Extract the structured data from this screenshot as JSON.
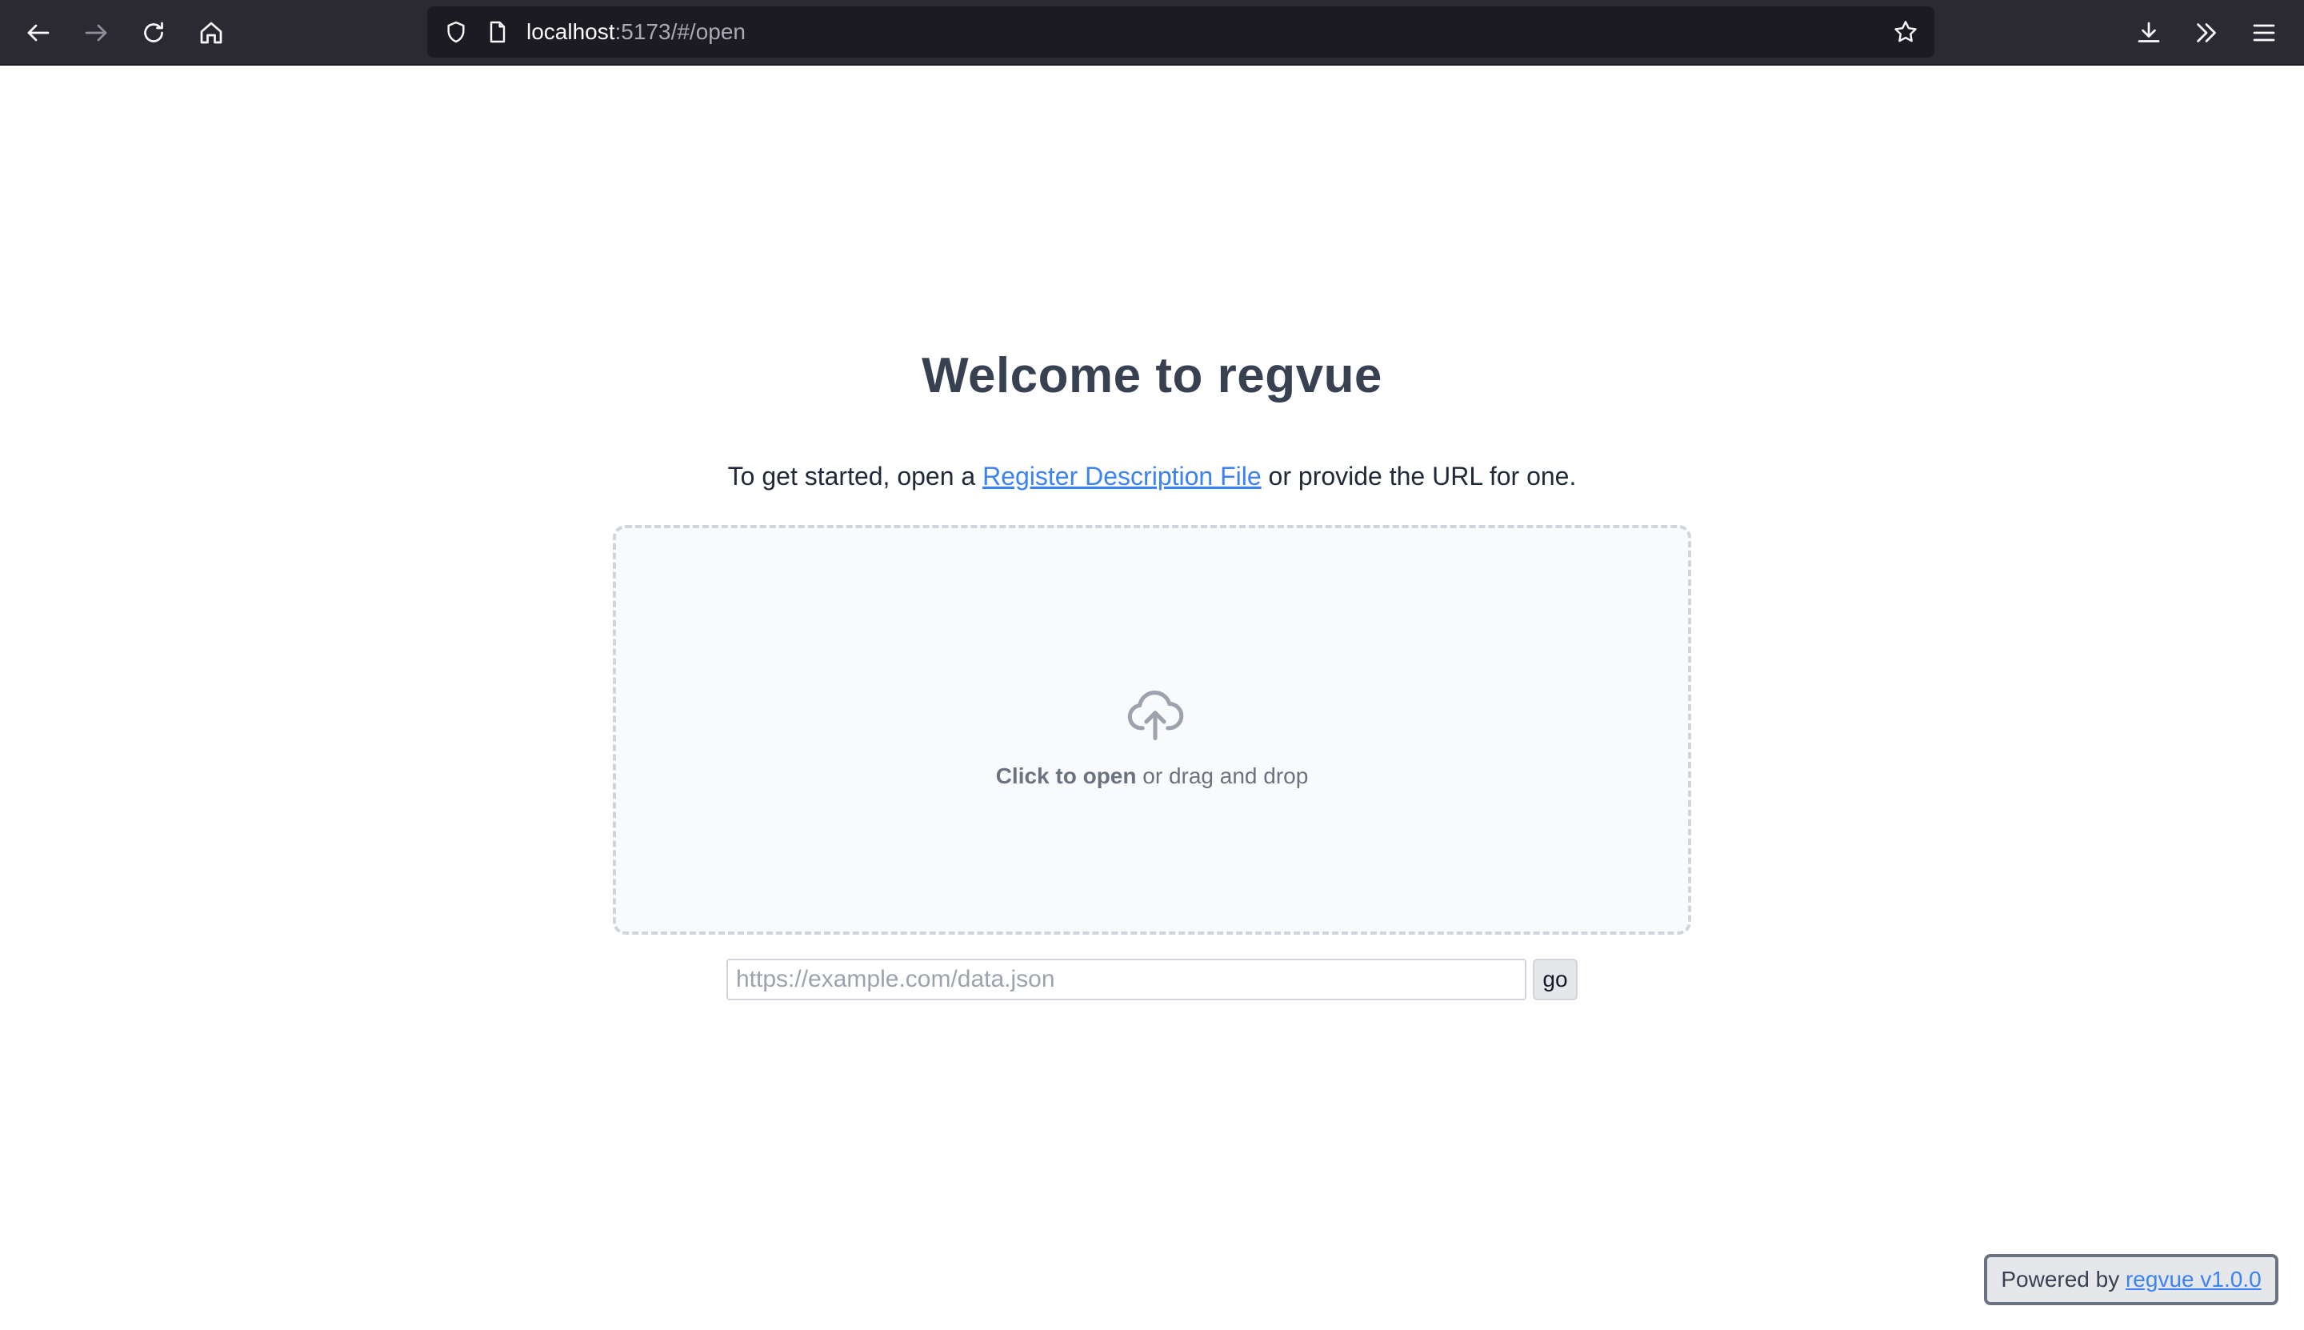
{
  "browser": {
    "url_host": "localhost",
    "url_rest": ":5173/#/open"
  },
  "page": {
    "title": "Welcome to regvue",
    "intro_before": "To get started, open a ",
    "intro_link": "Register Description File",
    "intro_after": " or provide the URL for one.",
    "dropzone": {
      "bold": "Click to open",
      "rest": " or drag and drop"
    },
    "url_input": {
      "value": "",
      "placeholder": "https://example.com/data.json"
    },
    "go_label": "go",
    "powered_by": "Powered by ",
    "powered_link": "regvue v1.0.0"
  },
  "colors": {
    "chrome_bg": "#2b2a33",
    "link": "#3b82f6",
    "title": "#374151"
  }
}
